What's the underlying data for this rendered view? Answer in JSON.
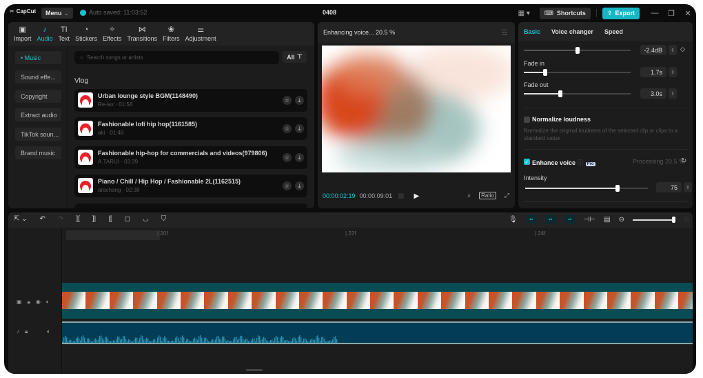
{
  "app": {
    "name": "CapCut",
    "menu_label": "Menu",
    "autosave": "Auto saved: 11:03:52",
    "project_title": "0408"
  },
  "toolbar": {
    "shortcuts_label": "Shortcuts",
    "export_label": "Export"
  },
  "tabs": [
    {
      "label": "Import",
      "icon": "import-icon"
    },
    {
      "label": "Audio",
      "icon": "audio-icon",
      "active": true
    },
    {
      "label": "Text",
      "icon": "text-icon"
    },
    {
      "label": "Stickers",
      "icon": "stickers-icon"
    },
    {
      "label": "Effects",
      "icon": "effects-icon"
    },
    {
      "label": "Transitions",
      "icon": "transitions-icon"
    },
    {
      "label": "Filters",
      "icon": "filters-icon"
    },
    {
      "label": "Adjustment",
      "icon": "adjustment-icon"
    }
  ],
  "categories": [
    "• Music",
    "Sound effe...",
    "Copyright",
    "Extract audio",
    "TikTok soun...",
    "Brand music"
  ],
  "search": {
    "placeholder": "Search songs or artists",
    "filter_label": "All"
  },
  "section_label": "Vlog",
  "songs": [
    {
      "title": "Urban lounge style BGM(1148490)",
      "meta": "Re-lax · 01:58"
    },
    {
      "title": "Fashionable lofi hip hop(1161585)",
      "meta": "aki · 01:46"
    },
    {
      "title": "Fashionable hip-hop for commercials and videos(979806)",
      "meta": "A.TARUI · 03:39"
    },
    {
      "title": "Piano / Chill / Hip Hop / Fashionable 2L(1162515)",
      "meta": "arachang · 02:38"
    }
  ],
  "preview": {
    "status": "Enhancing voice...  20.5 %",
    "current_time": "00:00:02:19",
    "total_time": "00:00:09:01",
    "ratio_label": "Ratio"
  },
  "right": {
    "tabs": [
      "Basic",
      "Voice changer",
      "Speed"
    ],
    "volume": {
      "value": "-2.4dB",
      "level": 0.5
    },
    "fade_in": {
      "label": "Fade in",
      "value": "1.7s",
      "level": 0.2
    },
    "fade_out": {
      "label": "Fade out",
      "value": "3.0s",
      "level": 0.34
    },
    "normalize": {
      "label": "Normalize loudness",
      "desc": "Normalize the original loudness of the selected clip or clips to a standard value",
      "checked": false
    },
    "enhance": {
      "label": "Enhance voice",
      "badge": "Pro",
      "status": "Processing  20.5 %",
      "checked": true
    },
    "intensity": {
      "label": "Intensity",
      "value": "75",
      "level": 0.75
    }
  },
  "timeline": {
    "ruler": [
      "| 20f",
      "| 22f",
      "| 24f"
    ]
  }
}
